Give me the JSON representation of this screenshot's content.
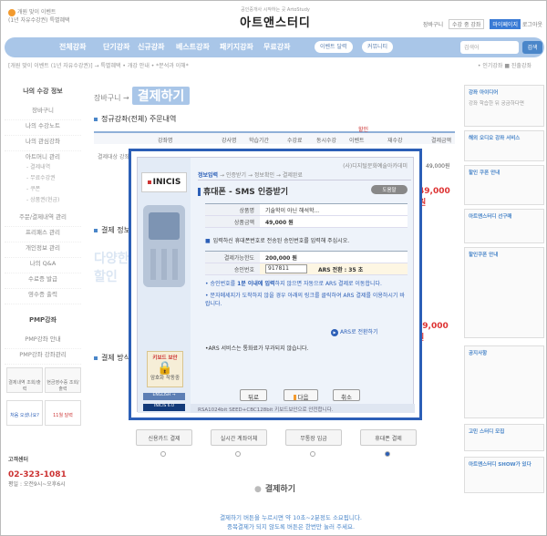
{
  "header": {
    "left_line1": "개원 맞이 이벤트",
    "left_line2": "(1년 자유수강권)",
    "left_line2b": "특별혜택",
    "brand_small": "공인중개사 시작하는 곳 ArtoStudy",
    "brand": "아트앤스터디",
    "right_cart": "장바구니",
    "right_select": "수강 중 강좌",
    "right_mypage": "마이페이지",
    "right_logout": "로그아웃"
  },
  "nav": {
    "items": [
      "전체강좌",
      "단기강좌",
      "신규강좌",
      "베스트강좌",
      "패키지강좌",
      "무료강좌"
    ],
    "pills": [
      "이벤트 달력",
      "커뮤니티"
    ],
    "search_placeholder": "검색어",
    "search_button": "검색"
  },
  "subbar": {
    "left": "[개원 맞이 이벤트 (1년 자유수강권)] → 특별혜택 • 개강 안내 • *분석과 이해*",
    "right": "• 인기강좌  ■ 진출강좌"
  },
  "left": {
    "title": "나의 수강 정보",
    "menu": [
      "장바구니",
      "나의 수강노트",
      "나의 관심강좌",
      "아트머니 관리"
    ],
    "submenu": [
      "- 결제내역",
      "- 무료수강권",
      "- 쿠폰",
      "- 상품권(현금)"
    ],
    "menu2": [
      "주문/결제내역 관리",
      "프리패스 관리",
      "개인정보 관리",
      "나의 Q&A",
      "수료증 발급",
      "영수증 출력"
    ],
    "pmp_title": "PMP강좌",
    "pmp_items": [
      "PMP강좌 안내",
      "PMP강좌 강좌관리"
    ],
    "box1": "결제내역 조회/출력",
    "box2": "현금영수증 조회/출력",
    "box3": "처음 오셨나요?",
    "box4": "11월 달력",
    "cs_title": "고객센터",
    "cs_tel": "02-323-1081",
    "cs_hours": "평일 : 오전9시~오후6시"
  },
  "main": {
    "crumb": "장바구니 →",
    "page_title": "결제하기",
    "sec1": "정규강좌(전체) 주문내역",
    "th": [
      "강좌명",
      "강사명",
      "학습기간",
      "수강료",
      "동시수강",
      "이벤트",
      "재수강",
      "할인",
      "결제금액"
    ],
    "row_text": "결제대상 강좌",
    "row_amount": "49,000원",
    "amount_red": "49,000 원",
    "sec2": "결제 정보",
    "discount": "다양한",
    "discount2": "할인",
    "sec3": "결제 방식",
    "pay_methods": [
      "신용카드 결제",
      "실시간 계좌이체",
      "무통장 입금",
      "휴대폰 결제"
    ],
    "pay_button": "결제하기",
    "footnote1": "결제하기 버튼을 누르시면 약 10초~2분정도 소요됩니다.",
    "footnote2": "중복결제가 되지 않도록 버튼은 한번만 눌러 주세요."
  },
  "right": {
    "box1_title": "강좌 아이디어",
    "box1_body": "강좌 학습한 뒤 궁금하다면",
    "box2_title": "해외 오디오 강좌 서비스",
    "box3_title": "할인 쿠폰 안내",
    "box4_title": "아트앤스터디 선구매",
    "box5_title": "할인쿠폰 안내",
    "box6_title": "공지사항",
    "box7_title": "고민 스터디 모집",
    "box8_title": "아트앤스터디 SHOW가 있다"
  },
  "popup": {
    "org": "(사)디지털문화예술아카데미",
    "steps": [
      "정보입력",
      "인증받기",
      "정보확인",
      "결제완료"
    ],
    "title": "휴대폰 - SMS 인증받기",
    "help": "도움말",
    "product_label": "상품명",
    "product_value": "기술학이 아닌 해석학...",
    "price_label": "상품금액",
    "price_value": "49,000 원",
    "notice": "입력하신 휴대폰번호로 전송된 승인번호를 입력해 주십시오.",
    "available_label": "결제가능한도",
    "available_value": "200,000 원",
    "approval_label": "승인번호",
    "approval_value": "917811",
    "ars_label": "ARS 전환 : 35 초",
    "bullet1_pre": "승인번호를 ",
    "bullet1_em": "1분 이내에 입력",
    "bullet1_post": "하지 않으면 자동으로 ARS 결제로 이동합니다.",
    "bullet2": "문자메세지가 도착하지 않을 경우 아래의 링크를 클릭하여 ARS 결제를 이용하시기 바랍니다.",
    "ars_link": "ARS로 전환하기",
    "ars_note": "•ARS 서비스는 통화료가 부과되지 않습니다.",
    "btn_back": "뒤로",
    "btn_next": "다음",
    "btn_cancel": "취소",
    "footer": "RSA1024bit SEED+CBC128bit 키보드보안으로 안전합니다.",
    "lock_line1": "키보드 보안",
    "lock_line2": "암호화 작동중",
    "english": "ENGLISH →",
    "inicis": "INICIS",
    "inicis60": "INICIS 6.0"
  }
}
